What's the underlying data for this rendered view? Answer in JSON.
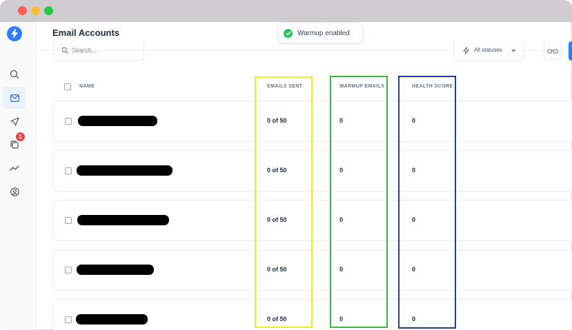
{
  "window": {
    "title_bar_colors": {
      "close": "#fe5f57",
      "minimize": "#febc2e",
      "zoom": "#28c840"
    }
  },
  "sidebar": {
    "logo_icon": "lightning-bolt-icon",
    "items": [
      {
        "icon": "search-icon"
      },
      {
        "icon": "mail-icon",
        "active": true
      },
      {
        "icon": "send-icon"
      },
      {
        "icon": "copy-icon",
        "badge": "1"
      },
      {
        "icon": "analytics-icon"
      },
      {
        "icon": "user-circle-icon"
      }
    ]
  },
  "header": {
    "title": "Email Accounts"
  },
  "toast": {
    "text": "Warmup enabled",
    "color": "#22c55e"
  },
  "toolbar": {
    "search_placeholder": "Search...",
    "status_filter": "All statuses"
  },
  "table": {
    "columns": {
      "name": "NAME",
      "emails_sent": "EMAILS SENT",
      "warmup_emails": "WARMUP EMAILS",
      "health_score": "HEALTH SCORE"
    },
    "rows": [
      {
        "emails_sent": "0 of 50",
        "warmup_emails": "0",
        "health_score": "0"
      },
      {
        "emails_sent": "0 of 50",
        "warmup_emails": "0",
        "health_score": "0"
      },
      {
        "emails_sent": "0 of 50",
        "warmup_emails": "0",
        "health_score": "0"
      },
      {
        "emails_sent": "0 of 50",
        "warmup_emails": "0",
        "health_score": "0"
      },
      {
        "emails_sent": "0 of 50",
        "warmup_emails": "0",
        "health_score": "0"
      }
    ]
  },
  "highlights": {
    "emails_sent": "#f2ea2d",
    "warmup_emails": "#35b63a",
    "health_score": "#2336a8"
  },
  "accent_color": "#2f7cf6"
}
